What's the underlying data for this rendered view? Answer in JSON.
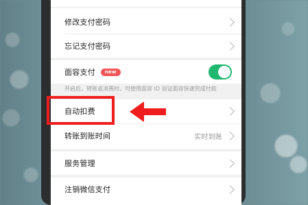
{
  "settings": {
    "rows": [
      {
        "label": "修改支付密码"
      },
      {
        "label": "忘记支付密码"
      },
      {
        "label": "面容支付",
        "badge": "new"
      },
      {
        "label": "自动扣费"
      },
      {
        "label": "转账到账时间",
        "value": "实时到账"
      },
      {
        "label": "服务管理"
      },
      {
        "label": "注销微信支付"
      }
    ],
    "face_pay_hint": "开启后，转账或消费时，可使用面容 ID 验证面容快速完成付款"
  },
  "colors": {
    "toggle_on": "#20b86f",
    "highlight": "#ef1d1d",
    "badge": "#f05658"
  }
}
